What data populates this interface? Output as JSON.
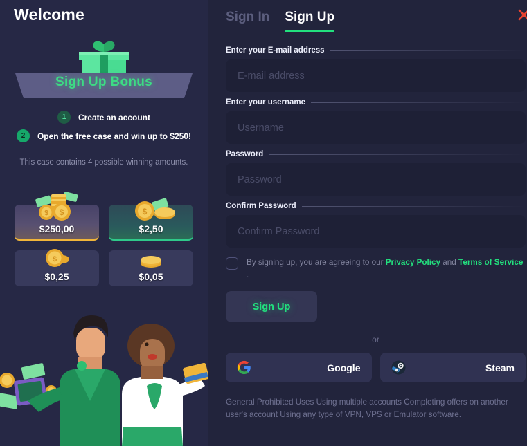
{
  "left": {
    "welcome_title": "Welcome",
    "banner_label": "Sign Up Bonus",
    "gift_icon": "gift-box-icon",
    "steps": [
      {
        "number": "1",
        "text": "Create an account"
      },
      {
        "number": "2",
        "text": "Open the free case and win up to $250!"
      }
    ],
    "case_note": "This case contains 4 possible winning amounts.",
    "prizes": [
      {
        "amount": "$250,00",
        "tier": "gold",
        "art": "coin-stack-cash-icon"
      },
      {
        "amount": "$2,50",
        "tier": "green",
        "art": "coins-cash-icon"
      },
      {
        "amount": "$0,25",
        "tier": "plain",
        "art": "single-coin-icon"
      },
      {
        "amount": "$0,05",
        "tier": "plain",
        "art": "small-coin-icon"
      }
    ],
    "illustration": "two-people-with-cash-illustration"
  },
  "right": {
    "close_icon": "close-icon",
    "tabs": [
      {
        "label": "Sign In",
        "active": false
      },
      {
        "label": "Sign Up",
        "active": true
      }
    ],
    "fields": [
      {
        "label": "Enter your E-mail address",
        "placeholder": "E-mail address",
        "value": "",
        "type": "text",
        "name": "email"
      },
      {
        "label": "Enter your username",
        "placeholder": "Username",
        "value": "",
        "type": "text",
        "name": "username"
      },
      {
        "label": "Password",
        "placeholder": "Password",
        "value": "",
        "type": "password",
        "name": "password"
      },
      {
        "label": "Confirm Password",
        "placeholder": "Confirm Password",
        "value": "",
        "type": "password",
        "name": "confirm-password"
      }
    ],
    "terms": {
      "checked": false,
      "prefix": "By signing up, you are agreeing to our ",
      "privacy_link": "Privacy Policy",
      "joiner": " and ",
      "terms_link": "Terms of Service",
      "suffix": " ."
    },
    "signup_button": "Sign Up",
    "or_text": "or",
    "social": [
      {
        "label": "Google",
        "icon": "google-icon"
      },
      {
        "label": "Steam",
        "icon": "steam-icon"
      }
    ],
    "disclaimer": "General Prohibited Uses Using multiple accounts Completing offers on another user's account Using any type of VPN, VPS or Emulator software."
  },
  "colors": {
    "accent_green": "#22e07e",
    "close_red": "#e8432f",
    "panel_bg": "#22243c",
    "left_bg": "#262845",
    "input_bg": "#1e2036",
    "gold": "#f0b53a"
  }
}
